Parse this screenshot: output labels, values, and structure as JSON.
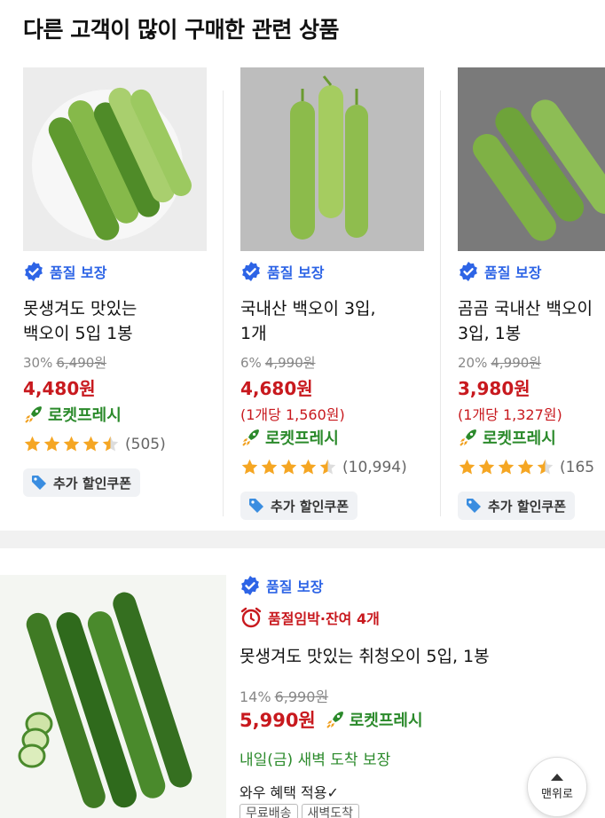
{
  "section_title": "다른 고객이 많이 구매한 관련 상품",
  "colors": {
    "accent_blue": "#2d64e6",
    "price_red": "#c8191e",
    "rocket_green": "#2b8a2b",
    "star_orange": "#f5a623"
  },
  "products": [
    {
      "badge": "품질 보장",
      "name_line1": "못생겨도 맛있는",
      "name_line2": "백오이 5입 1봉",
      "discount": "30%",
      "original_price": "6,490원",
      "price": "4,480원",
      "unit_price": "",
      "delivery_label": "로켓프레시",
      "rating": 4.5,
      "review_count": "(505)",
      "coupon": "추가 할인쿠폰"
    },
    {
      "badge": "품질 보장",
      "name_line1": "국내산 백오이 3입,",
      "name_line2": "1개",
      "discount": "6%",
      "original_price": "4,990원",
      "price": "4,680원",
      "unit_price": "(1개당 1,560원)",
      "delivery_label": "로켓프레시",
      "rating": 4.5,
      "review_count": "(10,994)",
      "coupon": "추가 할인쿠폰"
    },
    {
      "badge": "품질 보장",
      "name_line1": "곰곰 국내산 백오이",
      "name_line2": "3입, 1봉",
      "discount": "20%",
      "original_price": "4,990원",
      "price": "3,980원",
      "unit_price": "(1개당 1,327원)",
      "delivery_label": "로켓프레시",
      "rating": 4.5,
      "review_count": "(165",
      "coupon": "추가 할인쿠폰"
    }
  ],
  "list_item": {
    "badge": "품질 보장",
    "soldout": "품절임박·잔여 4개",
    "name": "못생겨도 맛있는 취청오이 5입, 1봉",
    "discount": "14%",
    "original_price": "6,990원",
    "price": "5,990원",
    "delivery_label": "로켓프레시",
    "delivery_note": "내일(금) 새벽 도착 보장",
    "wow": "와우 혜택 적용✓",
    "tags": [
      "무료배송",
      "새벽도착"
    ]
  },
  "top_button": "맨위로"
}
